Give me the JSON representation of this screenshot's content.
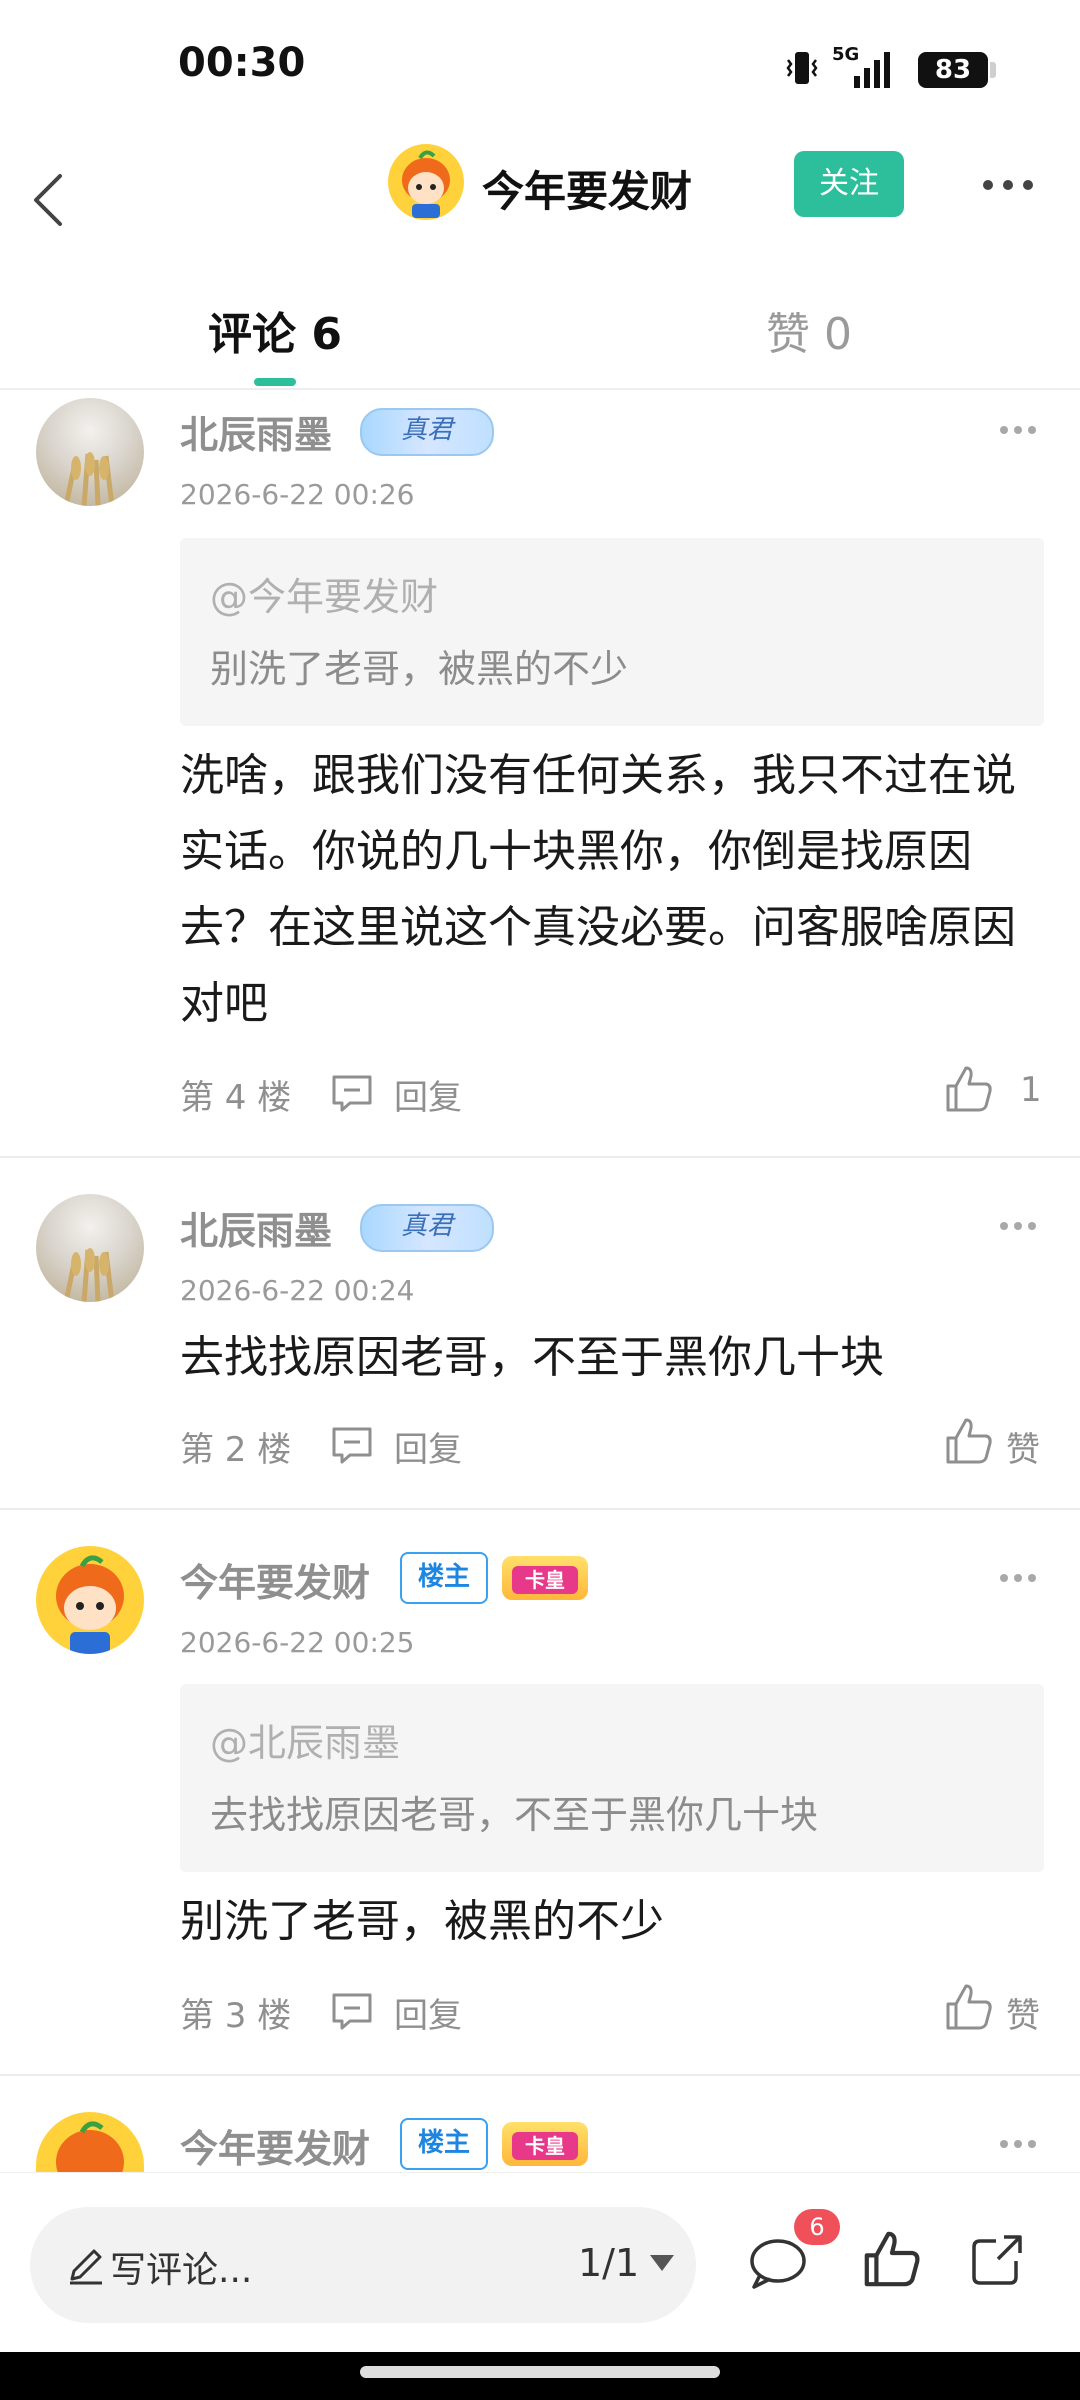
{
  "status_bar": {
    "time": "00:30",
    "network": "5G",
    "battery": "83"
  },
  "header": {
    "username": "今年要发财",
    "follow_label": "关注"
  },
  "tabs": [
    {
      "label": "评论 6"
    },
    {
      "label": "赞 0"
    }
  ],
  "comments": [
    {
      "username": "北辰雨墨",
      "badge_text": "真君",
      "date": "2026-6-22 00:26",
      "quote": {
        "user": "@今年要发财",
        "text": "别洗了老哥，被黑的不少"
      },
      "body": "洗啥，跟我们没有任何关系，我只不过在说实话。你说的几十块黑你，你倒是找原因去？在这里说这个真没必要。问客服啥原因对吧",
      "floor": "第 4 楼",
      "reply_label": "回复",
      "likes": "1"
    },
    {
      "username": "北辰雨墨",
      "badge_text": "真君",
      "date": "2026-6-22 00:24",
      "body": "去找找原因老哥，不至于黑你几十块",
      "floor": "第 2 楼",
      "reply_label": "回复",
      "likes": "赞"
    },
    {
      "username": "今年要发财",
      "owner_badge": "楼主",
      "crown_text": "卡皇",
      "date": "2026-6-22 00:25",
      "quote": {
        "user": "@北辰雨墨",
        "text": "去找找原因老哥，不至于黑你几十块"
      },
      "body": "别洗了老哥，被黑的不少",
      "floor": "第 3 楼",
      "reply_label": "回复",
      "likes": "赞"
    },
    {
      "username": "今年要发财",
      "owner_badge": "楼主",
      "crown_text": "卡皇"
    }
  ],
  "bottom_bar": {
    "input_placeholder": "写评论...",
    "page_indicator": "1/1",
    "comment_count": "6"
  },
  "colors": {
    "accent": "#2dbf9b",
    "badge_red": "#f0505a",
    "owner_blue": "#1e86e0"
  },
  "icons": [
    "back-icon",
    "more-icon",
    "reply-icon",
    "thumbs-up-icon",
    "pencil-icon",
    "comment-icon",
    "share-icon"
  ]
}
